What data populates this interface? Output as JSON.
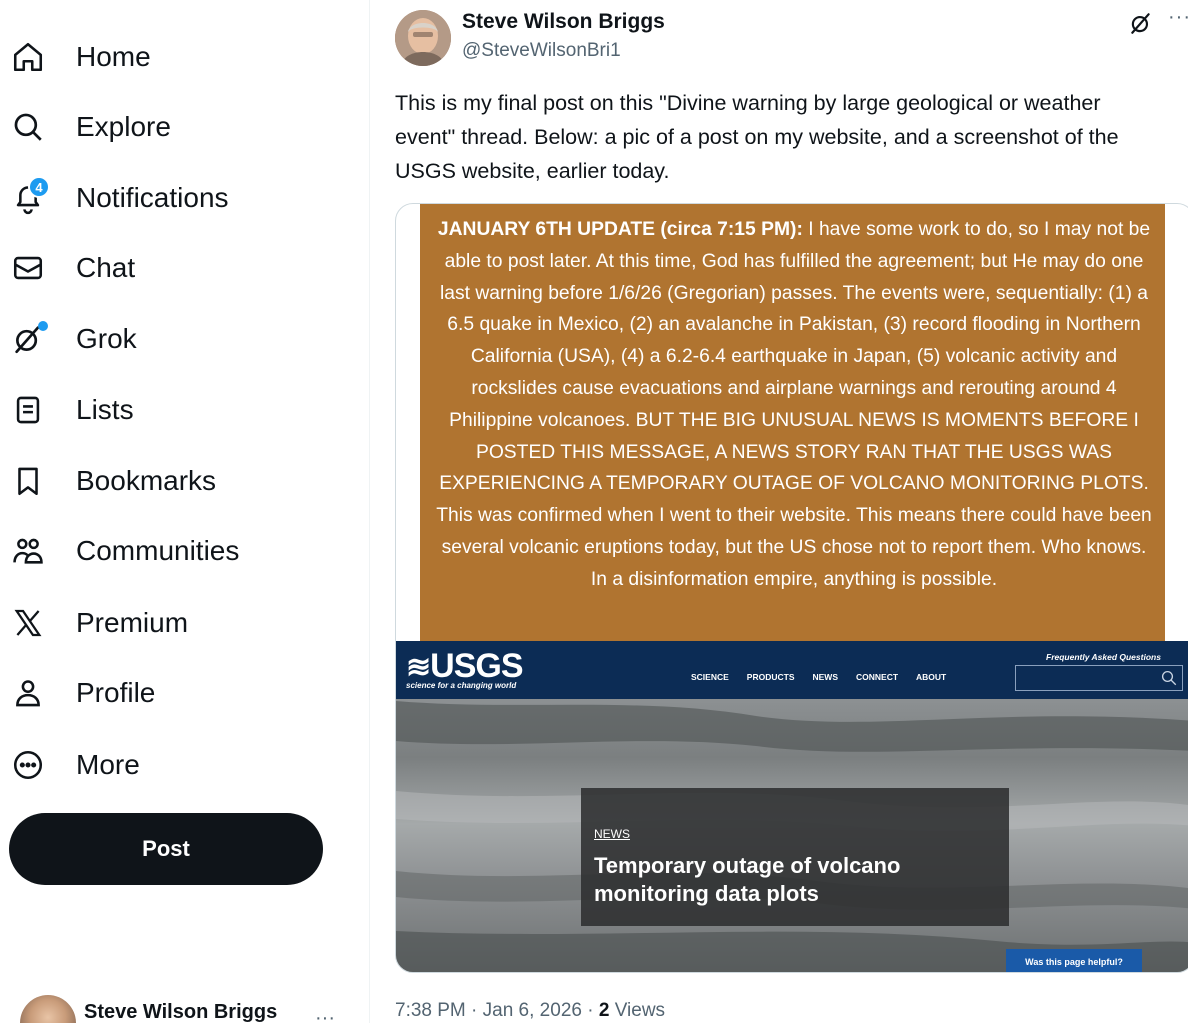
{
  "sidebar": {
    "items": [
      {
        "label": "Home",
        "icon": "home-icon"
      },
      {
        "label": "Explore",
        "icon": "search-icon"
      },
      {
        "label": "Notifications",
        "icon": "bell-icon",
        "badge": "4"
      },
      {
        "label": "Chat",
        "icon": "envelope-icon"
      },
      {
        "label": "Grok",
        "icon": "grok-icon"
      },
      {
        "label": "Lists",
        "icon": "list-icon"
      },
      {
        "label": "Bookmarks",
        "icon": "bookmark-icon"
      },
      {
        "label": "Communities",
        "icon": "people-icon"
      },
      {
        "label": "Premium",
        "icon": "x-logo-icon"
      },
      {
        "label": "Profile",
        "icon": "person-icon"
      },
      {
        "label": "More",
        "icon": "more-circle-icon"
      }
    ],
    "post_label": "Post",
    "account": {
      "name": "Steve Wilson Briggs",
      "more": "···"
    }
  },
  "tweet": {
    "author_name": "Steve Wilson Briggs",
    "author_handle": "@SteveWilsonBri1",
    "more": "···",
    "text": "This is my final post on this \"Divine warning by large geological or weather event\" thread. Below: a pic of a post on my website, and a screenshot of the USGS website, earlier today.",
    "image_text_lead": "JANUARY 6TH UPDATE (circa 7:15 PM):",
    "image_text_body": " I have some work to do, so I may not be able to post later. At this time, God has fulfilled the agreement; but He may do one last warning before 1/6/26 (Gregorian) passes. The events were, sequentially: (1) a 6.5 quake in Mexico, (2) an avalanche in Pakistan, (3) record flooding in Northern California (USA), (4) a 6.2-6.4 earthquake in Japan, (5) volcanic activity and rockslides cause evacuations and airplane warnings and rerouting around 4 Philippine volcanoes. BUT THE BIG UNUSUAL NEWS IS MOMENTS BEFORE I POSTED THIS MESSAGE, A NEWS STORY RAN THAT THE USGS WAS EXPERIENCING A TEMPORARY OUTAGE OF VOLCANO MONITORING PLOTS. This was confirmed when I went to their website. This means there could have been several volcanic eruptions today, but the US chose not to report them. Who knows. In a disinformation empire, anything is possible.",
    "usgs": {
      "logo": "USGS",
      "tagline": "science for a changing world",
      "nav": [
        "SCIENCE",
        "PRODUCTS",
        "NEWS",
        "CONNECT",
        "ABOUT"
      ],
      "faq": "Frequently Asked Questions",
      "news_tag": "NEWS",
      "news_title": "Temporary outage of volcano monitoring data plots",
      "helpful": "Was this page helpful?"
    },
    "time": "7:38 PM · Jan 6, 2026 · ",
    "views_count": "2",
    "views_label": " Views"
  },
  "colors": {
    "accent": "#1d9bf0",
    "text": "#0f1419",
    "muted": "#536471",
    "orange_panel": "#b07430",
    "usgs_navy": "#0c2c55"
  }
}
